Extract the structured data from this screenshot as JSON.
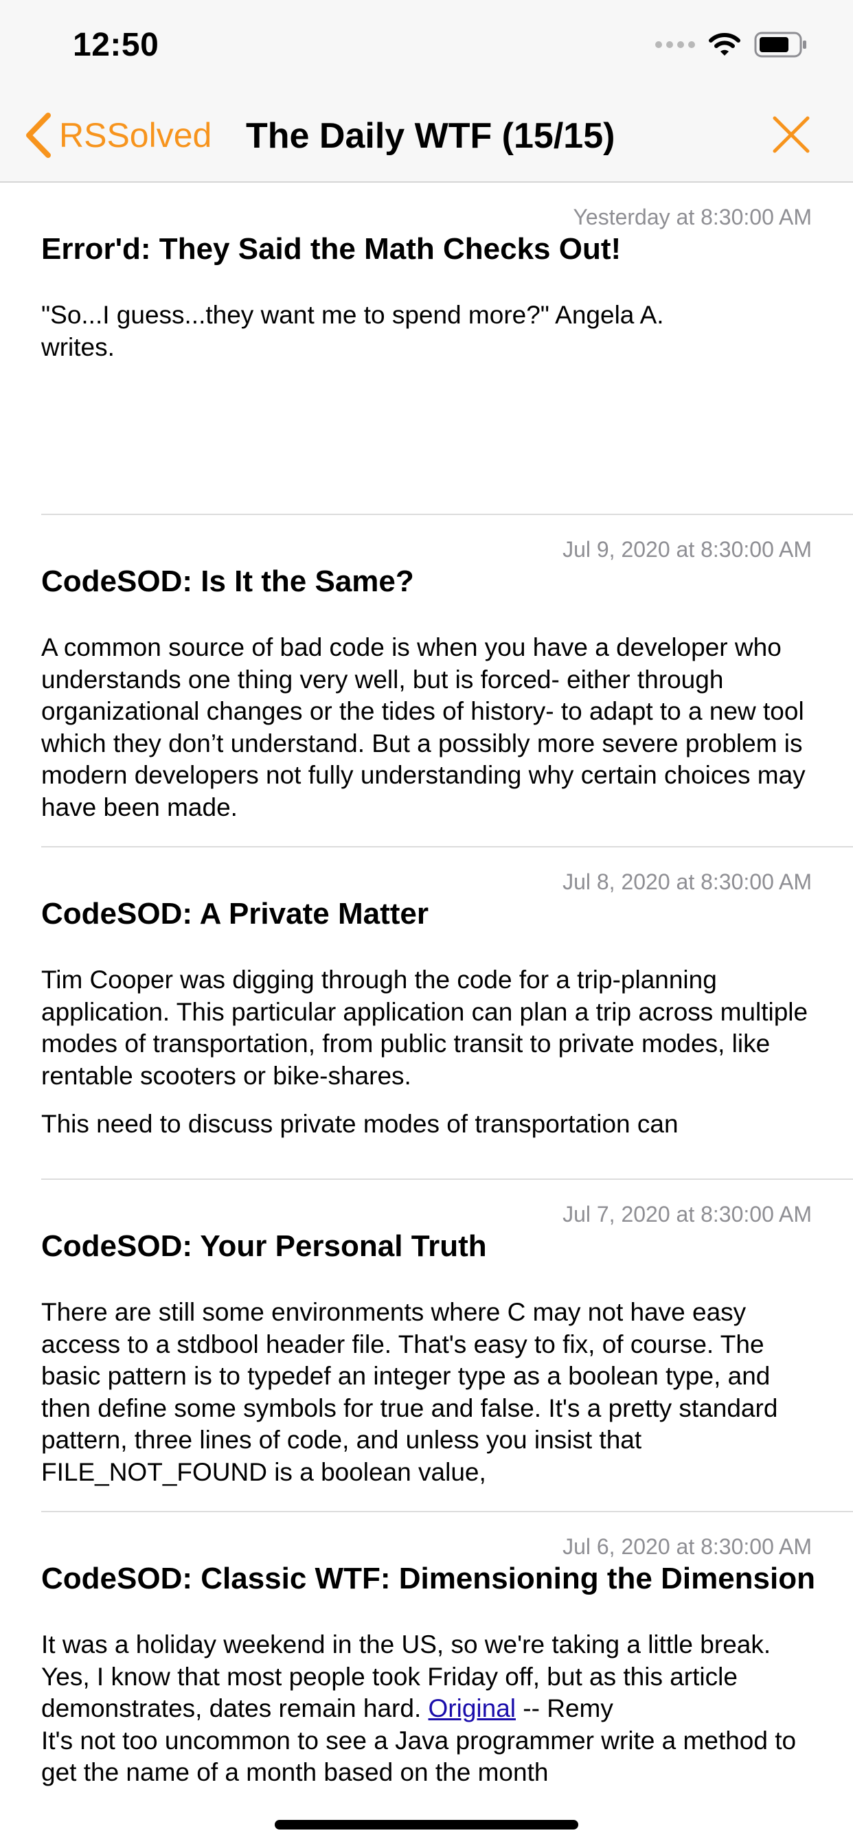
{
  "status_bar": {
    "time": "12:50",
    "icons": [
      "cellular-signal-icon",
      "wifi-icon",
      "battery-icon"
    ]
  },
  "nav": {
    "back_label": "RSSolved",
    "title": "The Daily WTF (15/15)",
    "accent_color": "#f7941d",
    "close_icon": "close-icon"
  },
  "articles": [
    {
      "date": "Yesterday at 8:30:00 AM",
      "title": "Error'd: They Said the Math Checks Out!",
      "body": [
        "\"So...I guess...they want me to spend more?\" Angela A. writes."
      ]
    },
    {
      "date": "Jul 9, 2020 at 8:30:00 AM",
      "title": "CodeSOD: Is It the Same?",
      "body": [
        "A common source of bad code is when you have a developer who understands one thing very well, but is forced- either through organizational changes or the tides of history- to adapt to a new tool which they don’t understand. But a possibly more severe problem is modern developers not fully understanding why certain choices may have been made."
      ]
    },
    {
      "date": "Jul 8, 2020 at 8:30:00 AM",
      "title": "CodeSOD: A Private Matter",
      "body": [
        "Tim Cooper was digging through the code for a trip-planning application. This particular application can plan a trip across multiple modes of transportation, from public transit to private modes, like rentable scooters or bike-shares.",
        "This need to discuss private modes of transportation can"
      ]
    },
    {
      "date": "Jul 7, 2020 at 8:30:00 AM",
      "title": "CodeSOD: Your Personal Truth",
      "body": [
        "There are still some environments where C may not have easy access to a stdbool header file. That's easy to fix, of course. The basic pattern is to typedef an integer type as a boolean type, and then define some symbols for true and false. It's a pretty standard pattern, three lines of code, and unless you insist that FILE_NOT_FOUND is a boolean value,"
      ]
    },
    {
      "date": "Jul 6, 2020 at 8:30:00 AM",
      "title": "CodeSOD: Classic WTF: Dimensioning the Dimension",
      "body_intro": "It was a holiday weekend in the US, so we're taking a little break. Yes, I know that most people took Friday off, but as this article demonstrates, dates remain hard.",
      "link_text": "Original",
      "body_after_link": "-- Remy",
      "body_more": "It's not too uncommon to see a Java programmer write a method to get the name of a month based on the month"
    }
  ]
}
